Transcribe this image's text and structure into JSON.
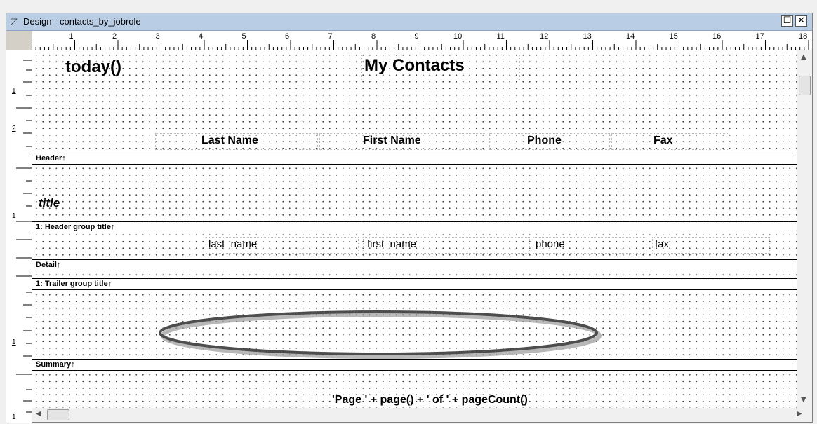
{
  "window": {
    "title": "Design - contacts_by_jobrole",
    "restore_label": "☐",
    "close_label": "✕"
  },
  "ruler": {
    "ticks": [
      "1",
      "2",
      "3",
      "4",
      "5",
      "6",
      "7",
      "8",
      "9",
      "10",
      "11",
      "12",
      "13",
      "14",
      "15",
      "16",
      "17",
      "18"
    ]
  },
  "vertical_ruler": {
    "header_marks": [
      "1",
      "2"
    ],
    "group_mark": "1",
    "summary_mark": "1",
    "footer_mark": "1"
  },
  "header": {
    "date_expr": "today()",
    "report_title": "My Contacts",
    "columns": [
      "Last Name",
      "First Name",
      "Phone",
      "Fax"
    ],
    "band_label": "Header↑"
  },
  "group": {
    "title_field": "title",
    "band_label": "1: Header group title↑"
  },
  "detail": {
    "fields": [
      "last_name",
      "first_name",
      "phone",
      "fax"
    ],
    "band_label": "Detail↑"
  },
  "trailer": {
    "band_label": "1: Trailer group title↑"
  },
  "summary": {
    "band_label": "Summary↑"
  },
  "footer": {
    "page_expr": "'Page ' + page() + ' of ' + pageCount()"
  },
  "colors": {
    "titlebar": "#b9cde5",
    "canvas": "#ffffff",
    "grid_dots": "#444444"
  },
  "icons": {
    "window_icon": "design-window-icon",
    "scroll_up": "scroll-up-icon",
    "scroll_down": "scroll-down-icon",
    "scroll_left": "scroll-left-icon",
    "scroll_right": "scroll-right-icon"
  }
}
